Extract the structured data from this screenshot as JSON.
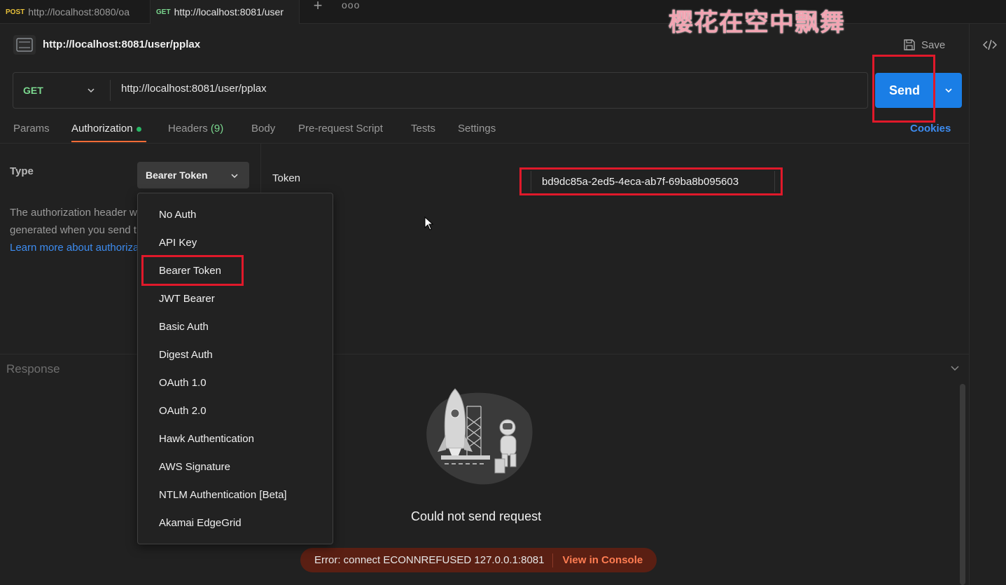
{
  "tabs": [
    {
      "method": "POST",
      "url": "http://localhost:8080/oa"
    },
    {
      "method": "GET",
      "url": "http://localhost:8081/user"
    }
  ],
  "tab_add_label": "+",
  "tab_more_label": "ooo",
  "watermark": "樱花在空中飘舞",
  "header": {
    "title": "http://localhost:8081/user/pplax",
    "save_label": "Save"
  },
  "request": {
    "method": "GET",
    "url": "http://localhost:8081/user/pplax",
    "send_label": "Send"
  },
  "request_tabs": {
    "params": "Params",
    "authorization": "Authorization",
    "headers": "Headers",
    "headers_count": "(9)",
    "body": "Body",
    "prerequest": "Pre-request Script",
    "tests": "Tests",
    "settings": "Settings",
    "cookies": "Cookies"
  },
  "auth": {
    "type_label": "Type",
    "selected_type": "Bearer Token",
    "desc_line1": "The authorization header will be automatically",
    "desc_line2": "generated when you send the request.",
    "learn_more": "Learn more about authorization",
    "token_label": "Token",
    "token_value": "bd9dc85a-2ed5-4eca-ab7f-69ba8b095603"
  },
  "auth_types": [
    "No Auth",
    "API Key",
    "Bearer Token",
    "JWT Bearer",
    "Basic Auth",
    "Digest Auth",
    "OAuth 1.0",
    "OAuth 2.0",
    "Hawk Authentication",
    "AWS Signature",
    "NTLM Authentication [Beta]",
    "Akamai EdgeGrid"
  ],
  "response": {
    "label": "Response",
    "message": "Could not send request",
    "error": "Error: connect ECONNREFUSED 127.0.0.1:8081",
    "console_link": "View in Console"
  },
  "colors": {
    "accent_blue": "#1a7ee6",
    "get_green": "#7bd88f",
    "post_yellow": "#e8c13a",
    "tab_underline": "#ff6c37",
    "annotation_red": "#e0192a",
    "error_bg": "#5a1f13"
  }
}
